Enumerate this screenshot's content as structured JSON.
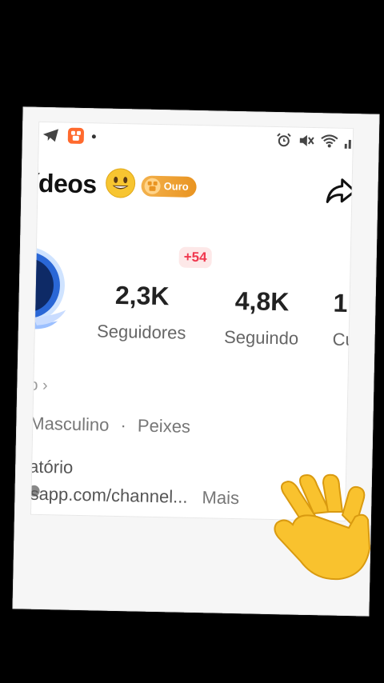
{
  "header": {
    "title": "ídeos",
    "badge_label": "Ouro"
  },
  "stats": {
    "new_followers": "+54",
    "followers_value": "2,3K",
    "followers_label": "Seguidores",
    "following_value": "4,8K",
    "following_label": "Seguindo",
    "third_value": "1",
    "third_label": "Cu"
  },
  "profile": {
    "link_text": "o ›",
    "gender": "Masculino",
    "separator": "·",
    "zodiac": "Peixes",
    "bio": "atório",
    "channel_link": "tsapp.com/channel...",
    "more_label": "Mais"
  },
  "icons": [
    "telegram-icon",
    "kwai-icon",
    "alarm-icon",
    "mute-icon",
    "wifi-icon",
    "signal-icon",
    "smiley-icon",
    "share-icon",
    "wave-hand-icon"
  ],
  "colors": {
    "badge": "#e99421",
    "new_followers": "#f0384f",
    "kwai_brand": "#ff6a2e"
  }
}
